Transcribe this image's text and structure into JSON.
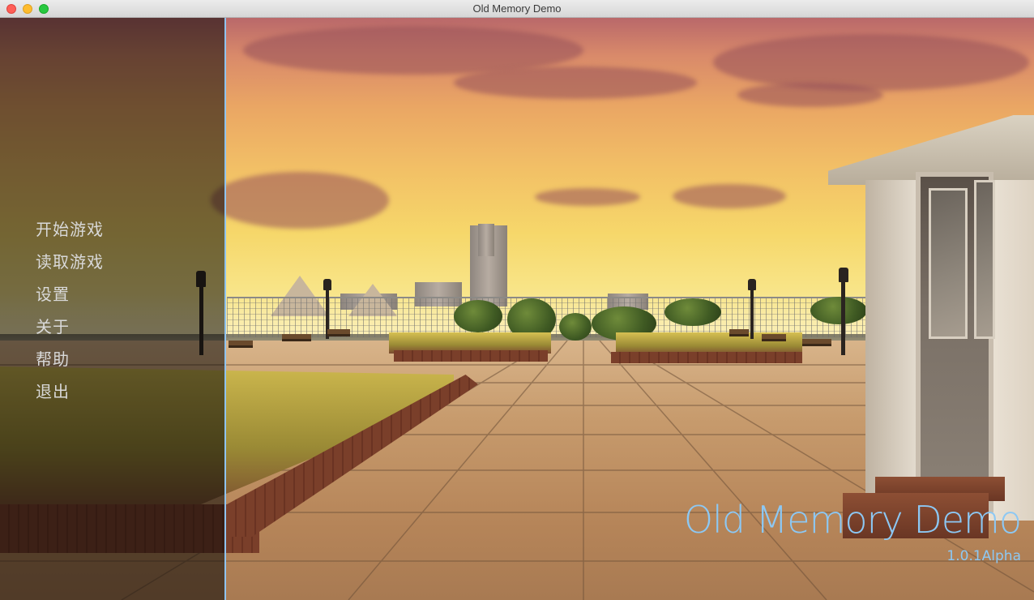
{
  "window": {
    "title": "Old Memory Demo"
  },
  "menu": {
    "items": [
      {
        "label": "开始游戏"
      },
      {
        "label": "读取游戏"
      },
      {
        "label": "设置"
      },
      {
        "label": "关于"
      },
      {
        "label": "帮助"
      },
      {
        "label": "退出"
      }
    ]
  },
  "branding": {
    "title": "Old Memory Demo",
    "version": "1.0.1Alpha",
    "accent_color": "#8cc8f4"
  },
  "background": {
    "scene": "rooftop-garden-sunset"
  }
}
